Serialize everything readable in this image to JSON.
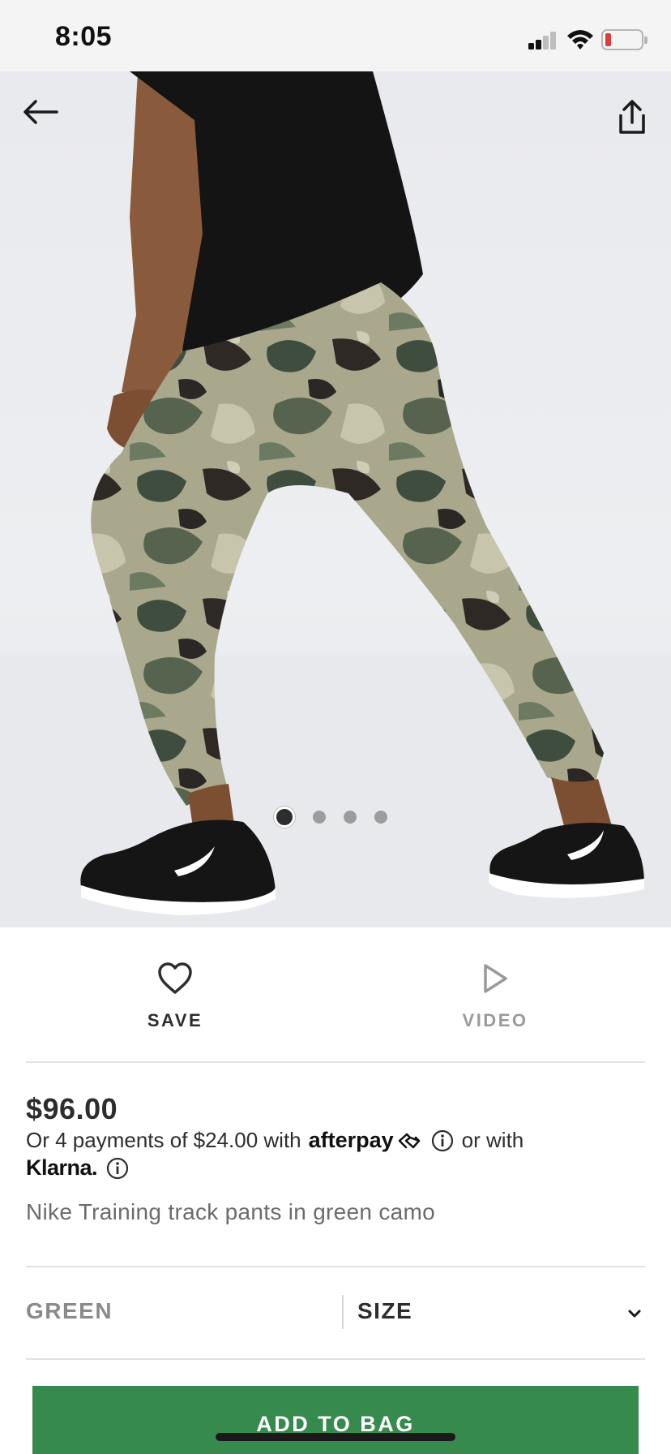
{
  "status_bar": {
    "time": "8:05",
    "icons": [
      "cellular-signal-icon",
      "wifi-icon",
      "battery-low-icon"
    ],
    "battery_color": "#e03a3a"
  },
  "product_image": {
    "nav_icons": [
      "back-arrow-icon",
      "share-icon"
    ],
    "carousel": {
      "total": 4,
      "active_index": 0
    }
  },
  "actions": {
    "save_label": "SAVE",
    "video_label": "VIDEO"
  },
  "pricing": {
    "price": "$96.00",
    "installment_text": "Or 4 payments of $24.00 with",
    "afterpay_logo": "afterpay",
    "or_with_text": "or with",
    "klarna_logo": "Klarna."
  },
  "product": {
    "name": "Nike Training track pants in green camo"
  },
  "variant": {
    "color_label": "GREEN",
    "size_label": "SIZE"
  },
  "cta": {
    "add_to_bag_label": "ADD TO BAG",
    "color": "#368a4e"
  }
}
